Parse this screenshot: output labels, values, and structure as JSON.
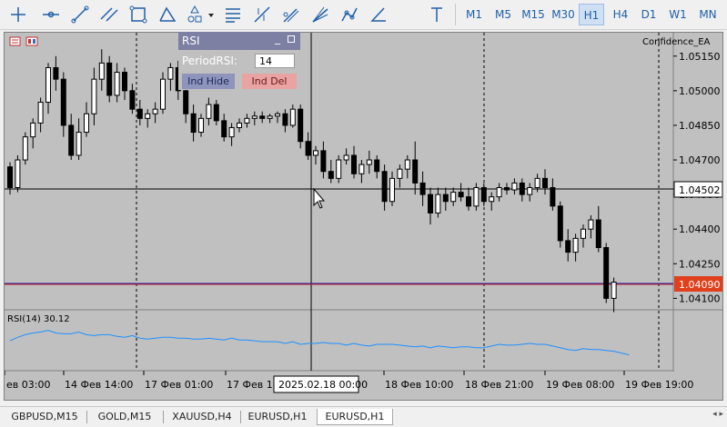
{
  "toolbar": {
    "tools": [
      "cursor-tool",
      "crosshair-tool",
      "trendline-tool",
      "channel-tool",
      "rectangle-tool",
      "triangle-tool",
      "shapes-tool",
      "fibonacci-tool",
      "gann-tool",
      "pitchfork-tool",
      "fan-tool",
      "polyline-tool",
      "angle-tool",
      "text-tool"
    ],
    "timeframes": [
      "M1",
      "M5",
      "M15",
      "M30",
      "H1",
      "H4",
      "D1",
      "W1",
      "MN"
    ],
    "active_timeframe": "H1"
  },
  "chart": {
    "indicator_label": "Confidence_EA",
    "price_axis": [
      "1.05150",
      "1.05000",
      "1.04850",
      "1.04700",
      "1.04550",
      "1.04400",
      "1.04250",
      "1.04100"
    ],
    "crosshair_price": "1.04502",
    "current_price": "1.04090",
    "rsi_label": "RSI(14) 30.12",
    "time_axis": [
      "ев 03:00",
      "14 Фев 14:00",
      "17 Фев 01:00",
      "17 Фев 12",
      "18 Фев 10:00",
      "18 Фев 21:00",
      "19 Фев 08:00",
      "19 Фев 19:00"
    ],
    "crosshair_time": "2025.02.18 00:00",
    "colors": {
      "background": "#c0c0c0",
      "bull": "#ffffff",
      "bear": "#000000",
      "rsi_line": "#1e90ff",
      "current_price": "#e0401c",
      "crosshair": "#000000"
    }
  },
  "rsi_panel": {
    "title": "RSI",
    "minimize": "_",
    "period_label": "PeriodRSI:",
    "period_value": "14",
    "hide_label": "Ind Hide",
    "delete_label": "Ind Del"
  },
  "chart_data": {
    "type": "candlestick",
    "symbol": "EURUSD",
    "timeframe": "H1",
    "ylim": [
      1.0407,
      1.0522
    ],
    "ohlc": [
      [
        1.0467,
        1.0469,
        1.0455,
        1.0458
      ],
      [
        1.0458,
        1.0472,
        1.0456,
        1.047
      ],
      [
        1.047,
        1.0482,
        1.0468,
        1.048
      ],
      [
        1.048,
        1.0488,
        1.0475,
        1.0486
      ],
      [
        1.0486,
        1.0497,
        1.0482,
        1.0495
      ],
      [
        1.0495,
        1.0512,
        1.049,
        1.051
      ],
      [
        1.051,
        1.0515,
        1.05,
        1.0505
      ],
      [
        1.0505,
        1.0508,
        1.048,
        1.0485
      ],
      [
        1.0485,
        1.049,
        1.047,
        1.0472
      ],
      [
        1.0472,
        1.0488,
        1.047,
        1.0482
      ],
      [
        1.0482,
        1.0495,
        1.048,
        1.049
      ],
      [
        1.049,
        1.051,
        1.0485,
        1.0505
      ],
      [
        1.0505,
        1.0518,
        1.05,
        1.0512
      ],
      [
        1.0512,
        1.0515,
        1.0495,
        1.0498
      ],
      [
        1.0498,
        1.0512,
        1.0495,
        1.0508
      ],
      [
        1.0508,
        1.051,
        1.0496,
        1.05
      ],
      [
        1.05,
        1.0503,
        1.049,
        1.0492
      ],
      [
        1.0492,
        1.0496,
        1.0485,
        1.0488
      ],
      [
        1.0488,
        1.0492,
        1.0484,
        1.049
      ],
      [
        1.049,
        1.0495,
        1.0486,
        1.0492
      ],
      [
        1.0492,
        1.0508,
        1.049,
        1.0505
      ],
      [
        1.0505,
        1.0512,
        1.05,
        1.051
      ],
      [
        1.051,
        1.0513,
        1.0496,
        1.05
      ],
      [
        1.05,
        1.0504,
        1.0486,
        1.049
      ],
      [
        1.049,
        1.0494,
        1.0478,
        1.0482
      ],
      [
        1.0482,
        1.049,
        1.048,
        1.0488
      ],
      [
        1.0488,
        1.0497,
        1.0485,
        1.0494
      ],
      [
        1.0494,
        1.0496,
        1.0485,
        1.0487
      ],
      [
        1.0487,
        1.049,
        1.0478,
        1.048
      ],
      [
        1.048,
        1.0486,
        1.0476,
        1.0484
      ],
      [
        1.0484,
        1.0488,
        1.0482,
        1.0486
      ],
      [
        1.0486,
        1.049,
        1.0484,
        1.0488
      ],
      [
        1.0488,
        1.0491,
        1.0485,
        1.0489
      ],
      [
        1.0489,
        1.0491,
        1.0486,
        1.0488
      ],
      [
        1.0488,
        1.049,
        1.0486,
        1.0489
      ],
      [
        1.0489,
        1.0491,
        1.0486,
        1.049
      ],
      [
        1.049,
        1.0492,
        1.0482,
        1.0485
      ],
      [
        1.0485,
        1.0494,
        1.0484,
        1.0492
      ],
      [
        1.0492,
        1.0494,
        1.0475,
        1.0478
      ],
      [
        1.0478,
        1.0482,
        1.047,
        1.0472
      ],
      [
        1.0472,
        1.0476,
        1.0468,
        1.0474
      ],
      [
        1.0474,
        1.0478,
        1.0462,
        1.0465
      ],
      [
        1.0465,
        1.047,
        1.046,
        1.0462
      ],
      [
        1.0462,
        1.0472,
        1.046,
        1.047
      ],
      [
        1.047,
        1.0475,
        1.0468,
        1.0472
      ],
      [
        1.0472,
        1.0476,
        1.0462,
        1.0464
      ],
      [
        1.0464,
        1.047,
        1.046,
        1.0468
      ],
      [
        1.0468,
        1.0474,
        1.0464,
        1.047
      ],
      [
        1.047,
        1.0472,
        1.0462,
        1.0465
      ],
      [
        1.0465,
        1.0468,
        1.0448,
        1.0452
      ],
      [
        1.0452,
        1.0465,
        1.045,
        1.0462
      ],
      [
        1.0462,
        1.0468,
        1.0458,
        1.0466
      ],
      [
        1.0466,
        1.0472,
        1.0462,
        1.047
      ],
      [
        1.047,
        1.0478,
        1.0455,
        1.046
      ],
      [
        1.046,
        1.0465,
        1.045,
        1.0455
      ],
      [
        1.0455,
        1.0458,
        1.0442,
        1.0447
      ],
      [
        1.0447,
        1.0458,
        1.0445,
        1.0455
      ],
      [
        1.0455,
        1.0458,
        1.0448,
        1.0452
      ],
      [
        1.0452,
        1.0458,
        1.045,
        1.0456
      ],
      [
        1.0456,
        1.046,
        1.0452,
        1.0454
      ],
      [
        1.0454,
        1.0458,
        1.0448,
        1.045
      ],
      [
        1.045,
        1.046,
        1.0448,
        1.0458
      ],
      [
        1.0458,
        1.046,
        1.045,
        1.0452
      ],
      [
        1.0452,
        1.0456,
        1.0448,
        1.0454
      ],
      [
        1.0454,
        1.046,
        1.0452,
        1.0458
      ],
      [
        1.0458,
        1.046,
        1.0455,
        1.0457
      ],
      [
        1.0457,
        1.0462,
        1.0455,
        1.046
      ],
      [
        1.046,
        1.0462,
        1.0452,
        1.0455
      ],
      [
        1.0455,
        1.046,
        1.0452,
        1.0458
      ],
      [
        1.0458,
        1.0464,
        1.0456,
        1.0462
      ],
      [
        1.0462,
        1.0466,
        1.0455,
        1.0458
      ],
      [
        1.0458,
        1.0462,
        1.0448,
        1.045
      ],
      [
        1.045,
        1.0452,
        1.0432,
        1.0435
      ],
      [
        1.0435,
        1.044,
        1.0426,
        1.043
      ],
      [
        1.043,
        1.0438,
        1.0426,
        1.0436
      ],
      [
        1.0436,
        1.0442,
        1.0432,
        1.044
      ],
      [
        1.044,
        1.0446,
        1.0436,
        1.0444
      ],
      [
        1.0444,
        1.045,
        1.043,
        1.0432
      ],
      [
        1.0432,
        1.0434,
        1.0408,
        1.041
      ],
      [
        1.041,
        1.0419,
        1.0404,
        1.0417
      ]
    ],
    "rsi": [
      48,
      52,
      55,
      57,
      58,
      60,
      57,
      56,
      56,
      58,
      55,
      54,
      55,
      55,
      53,
      52,
      54,
      51,
      50,
      51,
      52,
      52,
      51,
      51,
      50,
      50,
      51,
      50,
      49,
      51,
      49,
      49,
      48,
      47,
      47,
      47,
      45,
      47,
      44,
      45,
      45,
      46,
      45,
      45,
      43,
      45,
      43,
      42,
      44,
      44,
      44,
      43,
      42,
      41,
      42,
      40,
      42,
      41,
      40,
      41,
      41,
      40,
      40,
      42,
      44,
      43,
      43,
      44,
      45,
      44,
      44,
      42,
      40,
      38,
      37,
      39,
      38,
      38,
      37,
      36,
      34,
      32
    ]
  }
}
